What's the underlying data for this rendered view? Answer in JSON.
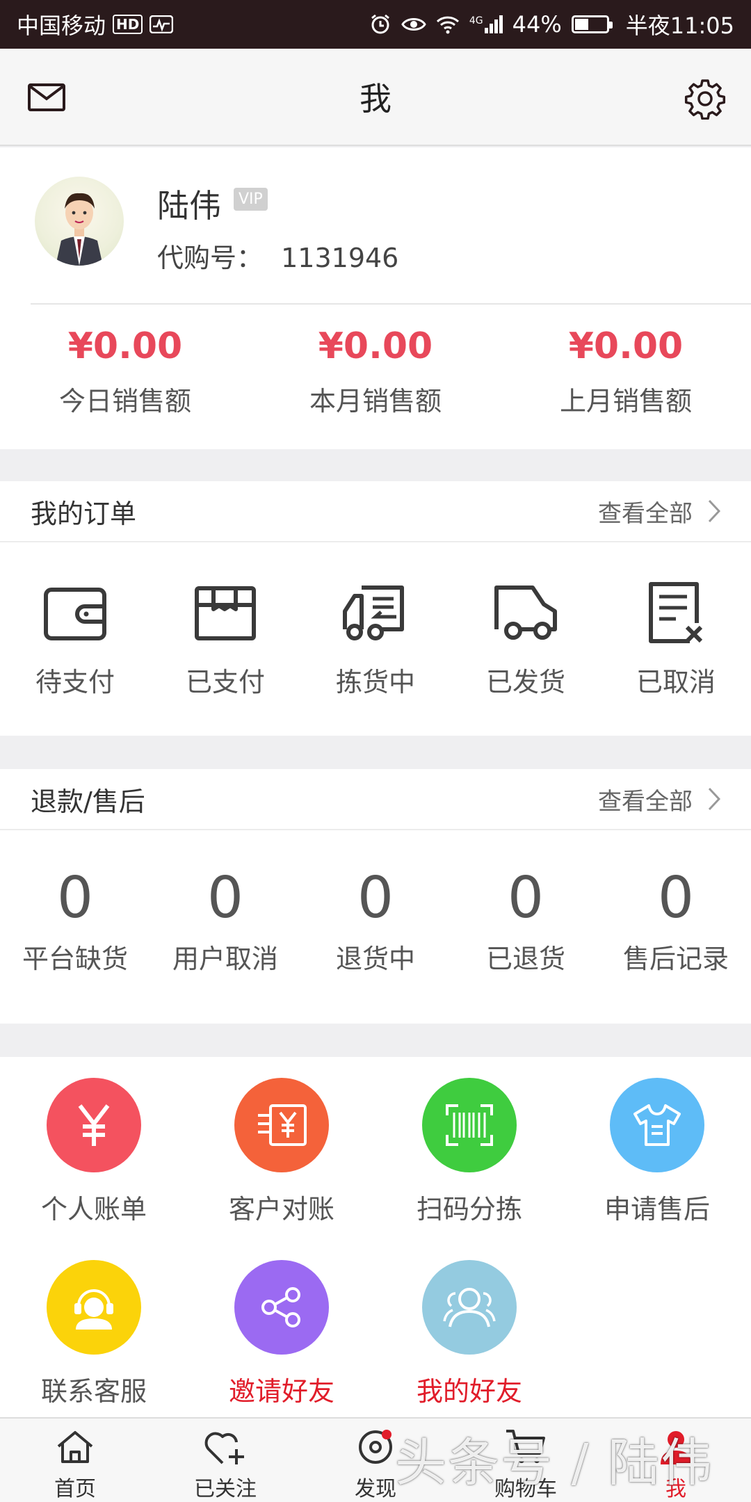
{
  "status_bar": {
    "carrier": "中国移动",
    "hd": "HD",
    "network": "4G",
    "battery": "44%",
    "battery_level": 0.44,
    "time": "半夜11:05"
  },
  "header": {
    "title": "我"
  },
  "profile": {
    "name": "陆伟",
    "vip": "VIP",
    "id_label": "代购号：",
    "id_value": "1131946"
  },
  "sales": [
    {
      "amount": "¥0.00",
      "label": "今日销售额"
    },
    {
      "amount": "¥0.00",
      "label": "本月销售额"
    },
    {
      "amount": "¥0.00",
      "label": "上月销售额"
    }
  ],
  "orders": {
    "title": "我的订单",
    "view_all": "查看全部",
    "items": [
      {
        "label": "待支付",
        "icon": "wallet-icon"
      },
      {
        "label": "已支付",
        "icon": "package-icon"
      },
      {
        "label": "拣货中",
        "icon": "picking-truck-icon"
      },
      {
        "label": "已发货",
        "icon": "delivery-truck-icon"
      },
      {
        "label": "已取消",
        "icon": "cancelled-document-icon"
      }
    ]
  },
  "refunds": {
    "title": "退款/售后",
    "view_all": "查看全部",
    "items": [
      {
        "count": "0",
        "label": "平台缺货"
      },
      {
        "count": "0",
        "label": "用户取消"
      },
      {
        "count": "0",
        "label": "退货中"
      },
      {
        "count": "0",
        "label": "已退货"
      },
      {
        "count": "0",
        "label": "售后记录"
      }
    ]
  },
  "tools": [
    {
      "label": "个人账单",
      "icon": "yen-icon",
      "color": "#f4525f"
    },
    {
      "label": "客户对账",
      "icon": "reconcile-icon",
      "color": "#f4623a"
    },
    {
      "label": "扫码分拣",
      "icon": "barcode-scan-icon",
      "color": "#3fcc3f"
    },
    {
      "label": "申请售后",
      "icon": "shirt-icon",
      "color": "#5ebcf7"
    },
    {
      "label": "联系客服",
      "icon": "customer-service-icon",
      "color": "#fbd30a"
    },
    {
      "label": "邀请好友",
      "icon": "share-icon",
      "color": "#9b6af2"
    },
    {
      "label": "我的好友",
      "icon": "friends-icon",
      "color": "#94cbe0"
    }
  ],
  "tabbar": [
    {
      "label": "首页",
      "icon": "home-icon"
    },
    {
      "label": "已关注",
      "icon": "heart-plus-icon"
    },
    {
      "label": "发现",
      "icon": "discover-icon"
    },
    {
      "label": "购物车",
      "icon": "cart-icon"
    },
    {
      "label": "我",
      "icon": "profile-icon"
    }
  ],
  "watermark": "头条号 / 陆伟"
}
